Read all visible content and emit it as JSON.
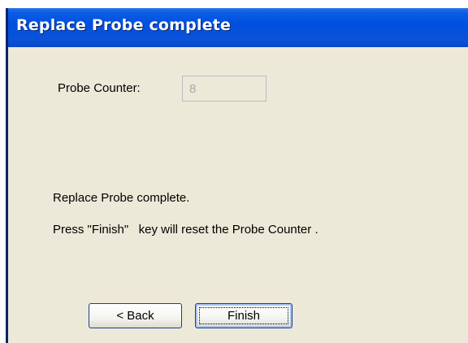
{
  "dialog": {
    "title": "Replace Probe complete"
  },
  "probe_counter": {
    "label": "Probe Counter:",
    "value": "8"
  },
  "messages": {
    "line1": "Replace Probe complete.",
    "line2": "Press \"Finish\"   key will reset the Probe Counter ."
  },
  "buttons": {
    "back_label": "< Back",
    "finish_label": "Finish"
  },
  "colors": {
    "titlebar": "#0050e0",
    "window_background": "#ece9d8",
    "title_text": "#ffffff",
    "disabled_text": "#a9a9a9"
  }
}
